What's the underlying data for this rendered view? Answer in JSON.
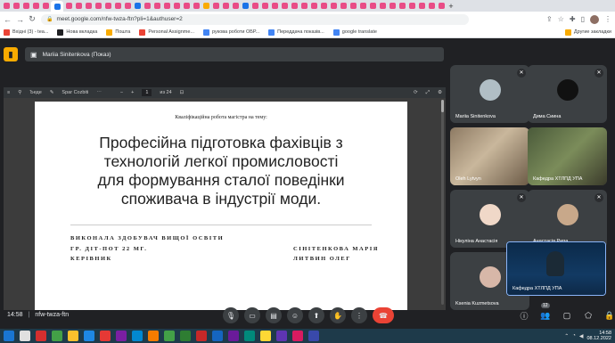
{
  "browser": {
    "tab_colors": [
      "#e94c86",
      "#e94c86",
      "#e94c86",
      "#e94c86",
      "#e94c86",
      "#1a73e8",
      "#e94c86",
      "#e94c86",
      "#e94c86",
      "#e94c86",
      "#e94c86",
      "#e94c86",
      "#e94c86",
      "#1a73e8",
      "#e94c86",
      "#e94c86",
      "#e94c86",
      "#e94c86",
      "#e94c86",
      "#e94c86",
      "#f9ab00",
      "#e94c86",
      "#e94c86",
      "#e94c86",
      "#1a73e8",
      "#e94c86",
      "#e94c86",
      "#e94c86",
      "#e94c86",
      "#e94c86",
      "#e94c86",
      "#e94c86",
      "#e94c86",
      "#e94c86",
      "#e94c86",
      "#e94c86",
      "#e94c86",
      "#e94c86",
      "#e94c86",
      "#e94c86",
      "#e94c86",
      "#e94c86",
      "#e94c86",
      "#e94c86",
      "#e94c86"
    ],
    "url": "meet.google.com/nfw-twza-ftn?pli=1&authuser=2",
    "bookmarks": [
      {
        "label": "Вхідні (3) - tea...",
        "color": "#ea4335"
      },
      {
        "label": "Нова вкладка",
        "color": "#202124"
      },
      {
        "label": "Пошта",
        "color": "#f9ab00"
      },
      {
        "label": "Personal Assignme...",
        "color": "#ea4335"
      },
      {
        "label": "рукова роботи ОБР...",
        "color": "#4285f4"
      },
      {
        "label": "Переддача показів...",
        "color": "#4285f4"
      },
      {
        "label": "google translate",
        "color": "#4285f4"
      }
    ],
    "other_bookmarks": "Другие закладки"
  },
  "meet": {
    "presenter_label": "Mariia Sinitenkova (Показ)",
    "pdf_toolbar": {
      "tool_a": "Ъеде",
      "tool_b": "Spar Cozbiti",
      "page_current": "1",
      "page_total": "из 24"
    },
    "slide": {
      "intro": "Кваліфікаційна робота магістра на тему:",
      "title_lines": [
        "Професійна підготовка фахівців з",
        "технологій легкої промисловості",
        "для формування сталої поведінки",
        "споживача в індустрії моди."
      ],
      "info_left_1": "ВИКОНАЛА ЗДОБУВАЧ ВИЩОЇ ОСВІТИ",
      "info_left_2": "ГР. ДІТ-ПОТ 22 МГ.",
      "info_left_3": "КЕРІВНИК",
      "info_right_2": "СІНІТЕНКОВА МАРІЯ",
      "info_right_3": "ЛИТВИН ОЛЕГ"
    },
    "participants": [
      {
        "name": "Mariia Sinitenkova"
      },
      {
        "name": "Дима Сиина"
      },
      {
        "name": "Oleh Lytvyn"
      },
      {
        "name": "Кафедра ХТЛПД УПА"
      },
      {
        "name": "Нікуліна Анастасія"
      },
      {
        "name": "Анастасія Рипа"
      },
      {
        "name": "Ksenia Kuzmetsova"
      }
    ],
    "self_name": "Кафедра ХТЛПД УПА",
    "time": "14:58",
    "separator": "|",
    "meeting_code": "nfw-twza-ftn",
    "people_count": "12"
  },
  "taskbar": {
    "clock_time": "14:58",
    "clock_date": "08.12.2022"
  }
}
